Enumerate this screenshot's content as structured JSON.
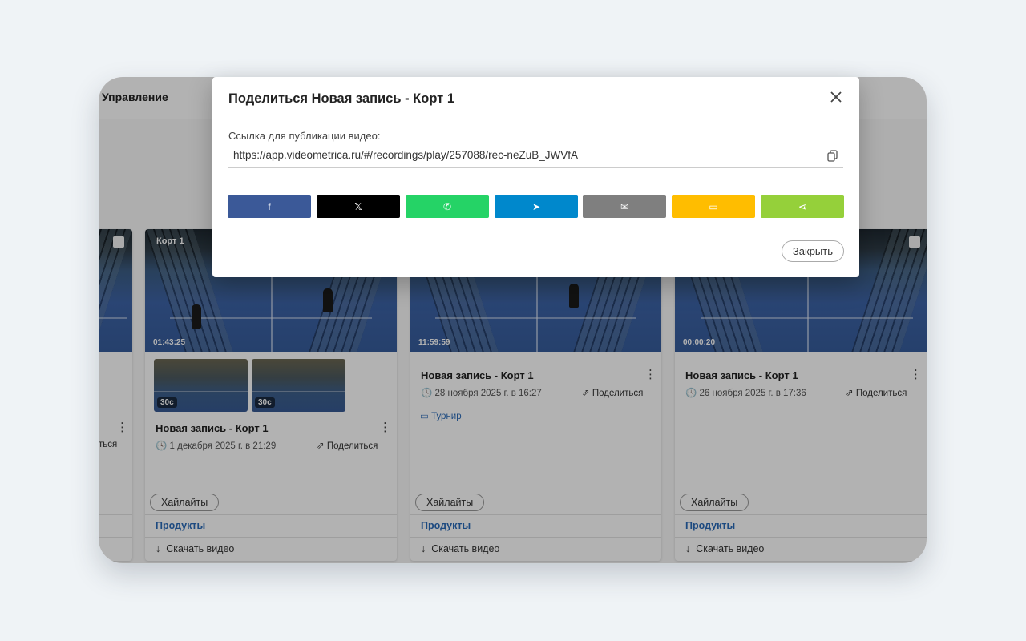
{
  "background_page": {
    "nav_label": "Управление",
    "cards": [
      {
        "share_label": "ться",
        "menu_icon": "kebab-menu-icon"
      },
      {
        "court_label": "Корт 1",
        "duration": "01:43:25",
        "highlights": [
          "30с",
          "30с"
        ],
        "title": "Новая запись - Корт 1",
        "date": "1 декабря 2025 г. в 21:29",
        "share_label": "Поделиться",
        "highlights_button": "Хайлайты",
        "products_link": "Продукты",
        "download_link": "Скачать видео"
      },
      {
        "duration": "11:59:59",
        "title": "Новая запись - Корт 1",
        "date": "28 ноября 2025 г. в 16:27",
        "share_label": "Поделиться",
        "tag": "Турнир",
        "highlights_button": "Хайлайты",
        "products_link": "Продукты",
        "download_link": "Скачать видео"
      },
      {
        "duration": "00:00:20",
        "title": "Новая запись - Корт 1",
        "date": "26 ноября 2025 г. в 17:36",
        "share_label": "Поделиться",
        "highlights_button": "Хайлайты",
        "products_link": "Продукты",
        "download_link": "Скачать видео"
      }
    ]
  },
  "modal": {
    "title": "Поделиться Новая запись - Корт 1",
    "link_label": "Ссылка для публикации видео:",
    "url": "https://app.videometrica.ru/#/recordings/play/257088/rec-neZuB_JWVfA",
    "share_buttons": [
      {
        "icon": "facebook-icon",
        "glyph": "f",
        "color": "#3b5998"
      },
      {
        "icon": "x-icon",
        "glyph": "𝕏",
        "color": "#000000"
      },
      {
        "icon": "whatsapp-icon",
        "glyph": "✆",
        "color": "#25d366"
      },
      {
        "icon": "telegram-icon",
        "glyph": "➤",
        "color": "#0088cc"
      },
      {
        "icon": "email-icon",
        "glyph": "✉",
        "color": "#7f7f7f"
      },
      {
        "icon": "sms-icon",
        "glyph": "▭",
        "color": "#ffbd00"
      },
      {
        "icon": "share-icon",
        "glyph": "⋖",
        "color": "#95d03a"
      }
    ],
    "close_button": "Закрыть"
  }
}
